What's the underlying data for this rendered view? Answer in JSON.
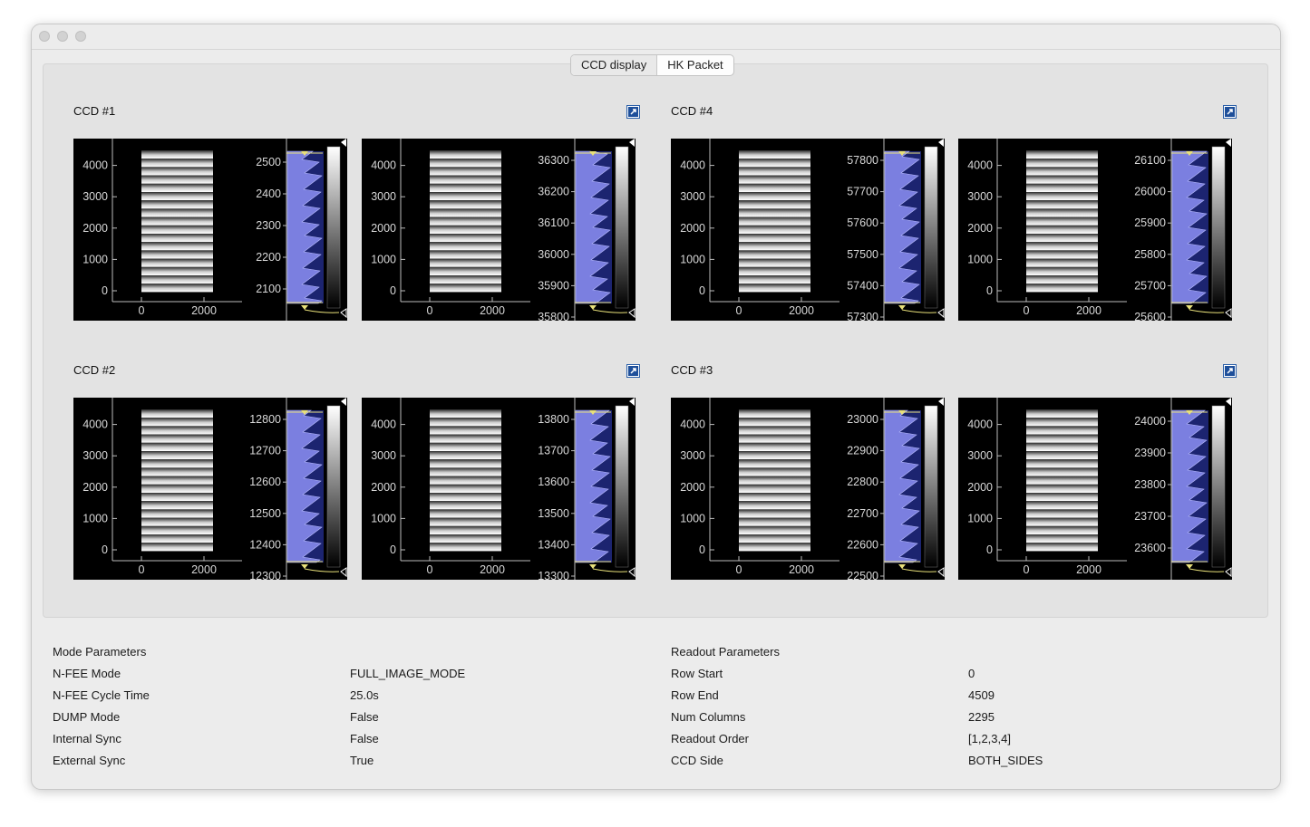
{
  "tabs": [
    {
      "label": "CCD display",
      "active": false
    },
    {
      "label": "HK Packet",
      "active": true
    }
  ],
  "image_axis": {
    "y_ticks": [
      "0",
      "1000",
      "2000",
      "3000",
      "4000"
    ],
    "x_ticks": [
      "0",
      "2000"
    ]
  },
  "ccd_groups": [
    {
      "title": "CCD #1",
      "expand_icon": "expand-icon",
      "plots": [
        {
          "hist_ticks": [
            "2500",
            "2400",
            "2300",
            "2200",
            "2100"
          ]
        },
        {
          "hist_ticks": [
            "36300",
            "36200",
            "36100",
            "36000",
            "35900",
            "35800"
          ]
        }
      ]
    },
    {
      "title": "CCD #4",
      "expand_icon": "expand-icon",
      "plots": [
        {
          "hist_ticks": [
            "57800",
            "57700",
            "57600",
            "57500",
            "57400",
            "57300"
          ]
        },
        {
          "hist_ticks": [
            "26100",
            "26000",
            "25900",
            "25800",
            "25700",
            "25600"
          ]
        }
      ]
    },
    {
      "title": "CCD #2",
      "expand_icon": "expand-icon",
      "plots": [
        {
          "hist_ticks": [
            "12800",
            "12700",
            "12600",
            "12500",
            "12400",
            "12300"
          ]
        },
        {
          "hist_ticks": [
            "13800",
            "13700",
            "13600",
            "13500",
            "13400",
            "13300"
          ]
        }
      ]
    },
    {
      "title": "CCD #3",
      "expand_icon": "expand-icon",
      "plots": [
        {
          "hist_ticks": [
            "23000",
            "22900",
            "22800",
            "22700",
            "22600",
            "22500"
          ]
        },
        {
          "hist_ticks": [
            "24000",
            "23900",
            "23800",
            "23700",
            "23600"
          ]
        }
      ]
    }
  ],
  "mode_parameters": {
    "title": "Mode Parameters",
    "rows": [
      {
        "label": "N-FEE Mode",
        "value": "FULL_IMAGE_MODE"
      },
      {
        "label": "N-FEE Cycle Time",
        "value": "25.0s"
      },
      {
        "label": "DUMP Mode",
        "value": "False"
      },
      {
        "label": "Internal Sync",
        "value": "False"
      },
      {
        "label": "External Sync",
        "value": "True"
      }
    ]
  },
  "readout_parameters": {
    "title": "Readout Parameters",
    "rows": [
      {
        "label": "Row Start",
        "value": "0"
      },
      {
        "label": "Row End",
        "value": "4509"
      },
      {
        "label": "Num Columns",
        "value": "2295"
      },
      {
        "label": "Readout Order",
        "value": "[1,2,3,4]"
      },
      {
        "label": "CCD Side",
        "value": "BOTH_SIDES"
      }
    ]
  },
  "colors": {
    "histogram_fill": "#7b7fe0",
    "histogram_line": "#b9bcff",
    "level_marker": "#e8e07a",
    "plot_background": "#000000",
    "axis": "#bdbdbd"
  }
}
